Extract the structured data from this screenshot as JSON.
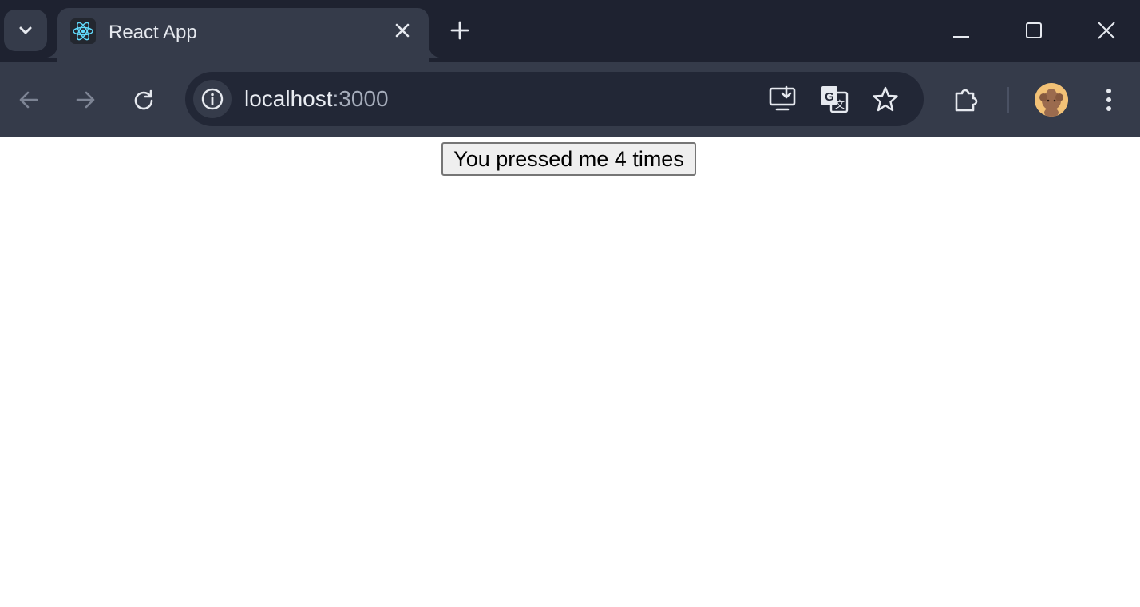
{
  "browser": {
    "tab": {
      "title": "React App",
      "favicon": "react-logo-icon"
    },
    "address_bar": {
      "host": "localhost",
      "port": ":3000"
    },
    "icons": {
      "tab_search": "chevron-down-icon",
      "tab_close": "close-icon",
      "new_tab": "plus-icon",
      "minimize": "minimize-icon",
      "maximize": "maximize-icon",
      "close_window": "close-icon",
      "back": "back-arrow-icon",
      "forward": "forward-arrow-icon",
      "reload": "reload-icon",
      "site_info": "info-icon",
      "install_app": "install-app-icon",
      "translate": "translate-icon",
      "bookmark": "star-icon",
      "extensions": "puzzle-icon",
      "profile": "avatar",
      "menu": "kebab-menu-icon"
    },
    "colors": {
      "tabstrip_bg": "#1e2230",
      "toolbar_bg": "#353b4a",
      "omnibox_bg": "#222736"
    }
  },
  "page": {
    "button_label": "You pressed me 4 times"
  }
}
